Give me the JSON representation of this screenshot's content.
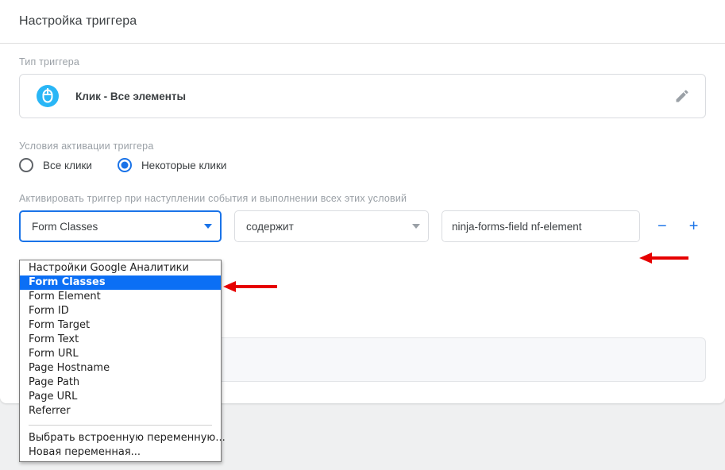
{
  "header": {
    "title": "Настройка триггера"
  },
  "trigger_type": {
    "label": "Тип триггера",
    "name": "Клик - Все элементы",
    "icon": "mouse-click-icon",
    "edit_icon": "pencil-icon"
  },
  "activation": {
    "label": "Условия активации триггера",
    "options": [
      {
        "label": "Все клики",
        "checked": false
      },
      {
        "label": "Некоторые клики",
        "checked": true
      }
    ]
  },
  "conditions": {
    "label": "Активировать триггер при наступлении события и выполнении всех этих условий",
    "variable_value": "Form Classes",
    "operator_value": "содержит",
    "value_value": "ninja-forms-field nf-element",
    "remove_label": "−",
    "add_label": "+"
  },
  "dropdown": {
    "open": true,
    "items": [
      {
        "label": "Настройки Google Аналитики",
        "selected": false
      },
      {
        "label": "Form Classes",
        "selected": true
      },
      {
        "label": "Form Element",
        "selected": false
      },
      {
        "label": "Form ID",
        "selected": false
      },
      {
        "label": "Form Target",
        "selected": false
      },
      {
        "label": "Form Text",
        "selected": false
      },
      {
        "label": "Form URL",
        "selected": false
      },
      {
        "label": "Page Hostname",
        "selected": false
      },
      {
        "label": "Page Path",
        "selected": false
      },
      {
        "label": "Page URL",
        "selected": false
      },
      {
        "label": "Referrer",
        "selected": false
      }
    ],
    "footer_items": [
      {
        "label": "Выбрать встроенную переменную..."
      },
      {
        "label": "Новая переменная..."
      }
    ]
  },
  "colors": {
    "accent_blue": "#1a73e8",
    "icon_cyan": "#29b6f6",
    "highlight_blue": "#0b6ff5",
    "annotation_red": "#e60000",
    "page_bg": "#eff0f1"
  }
}
